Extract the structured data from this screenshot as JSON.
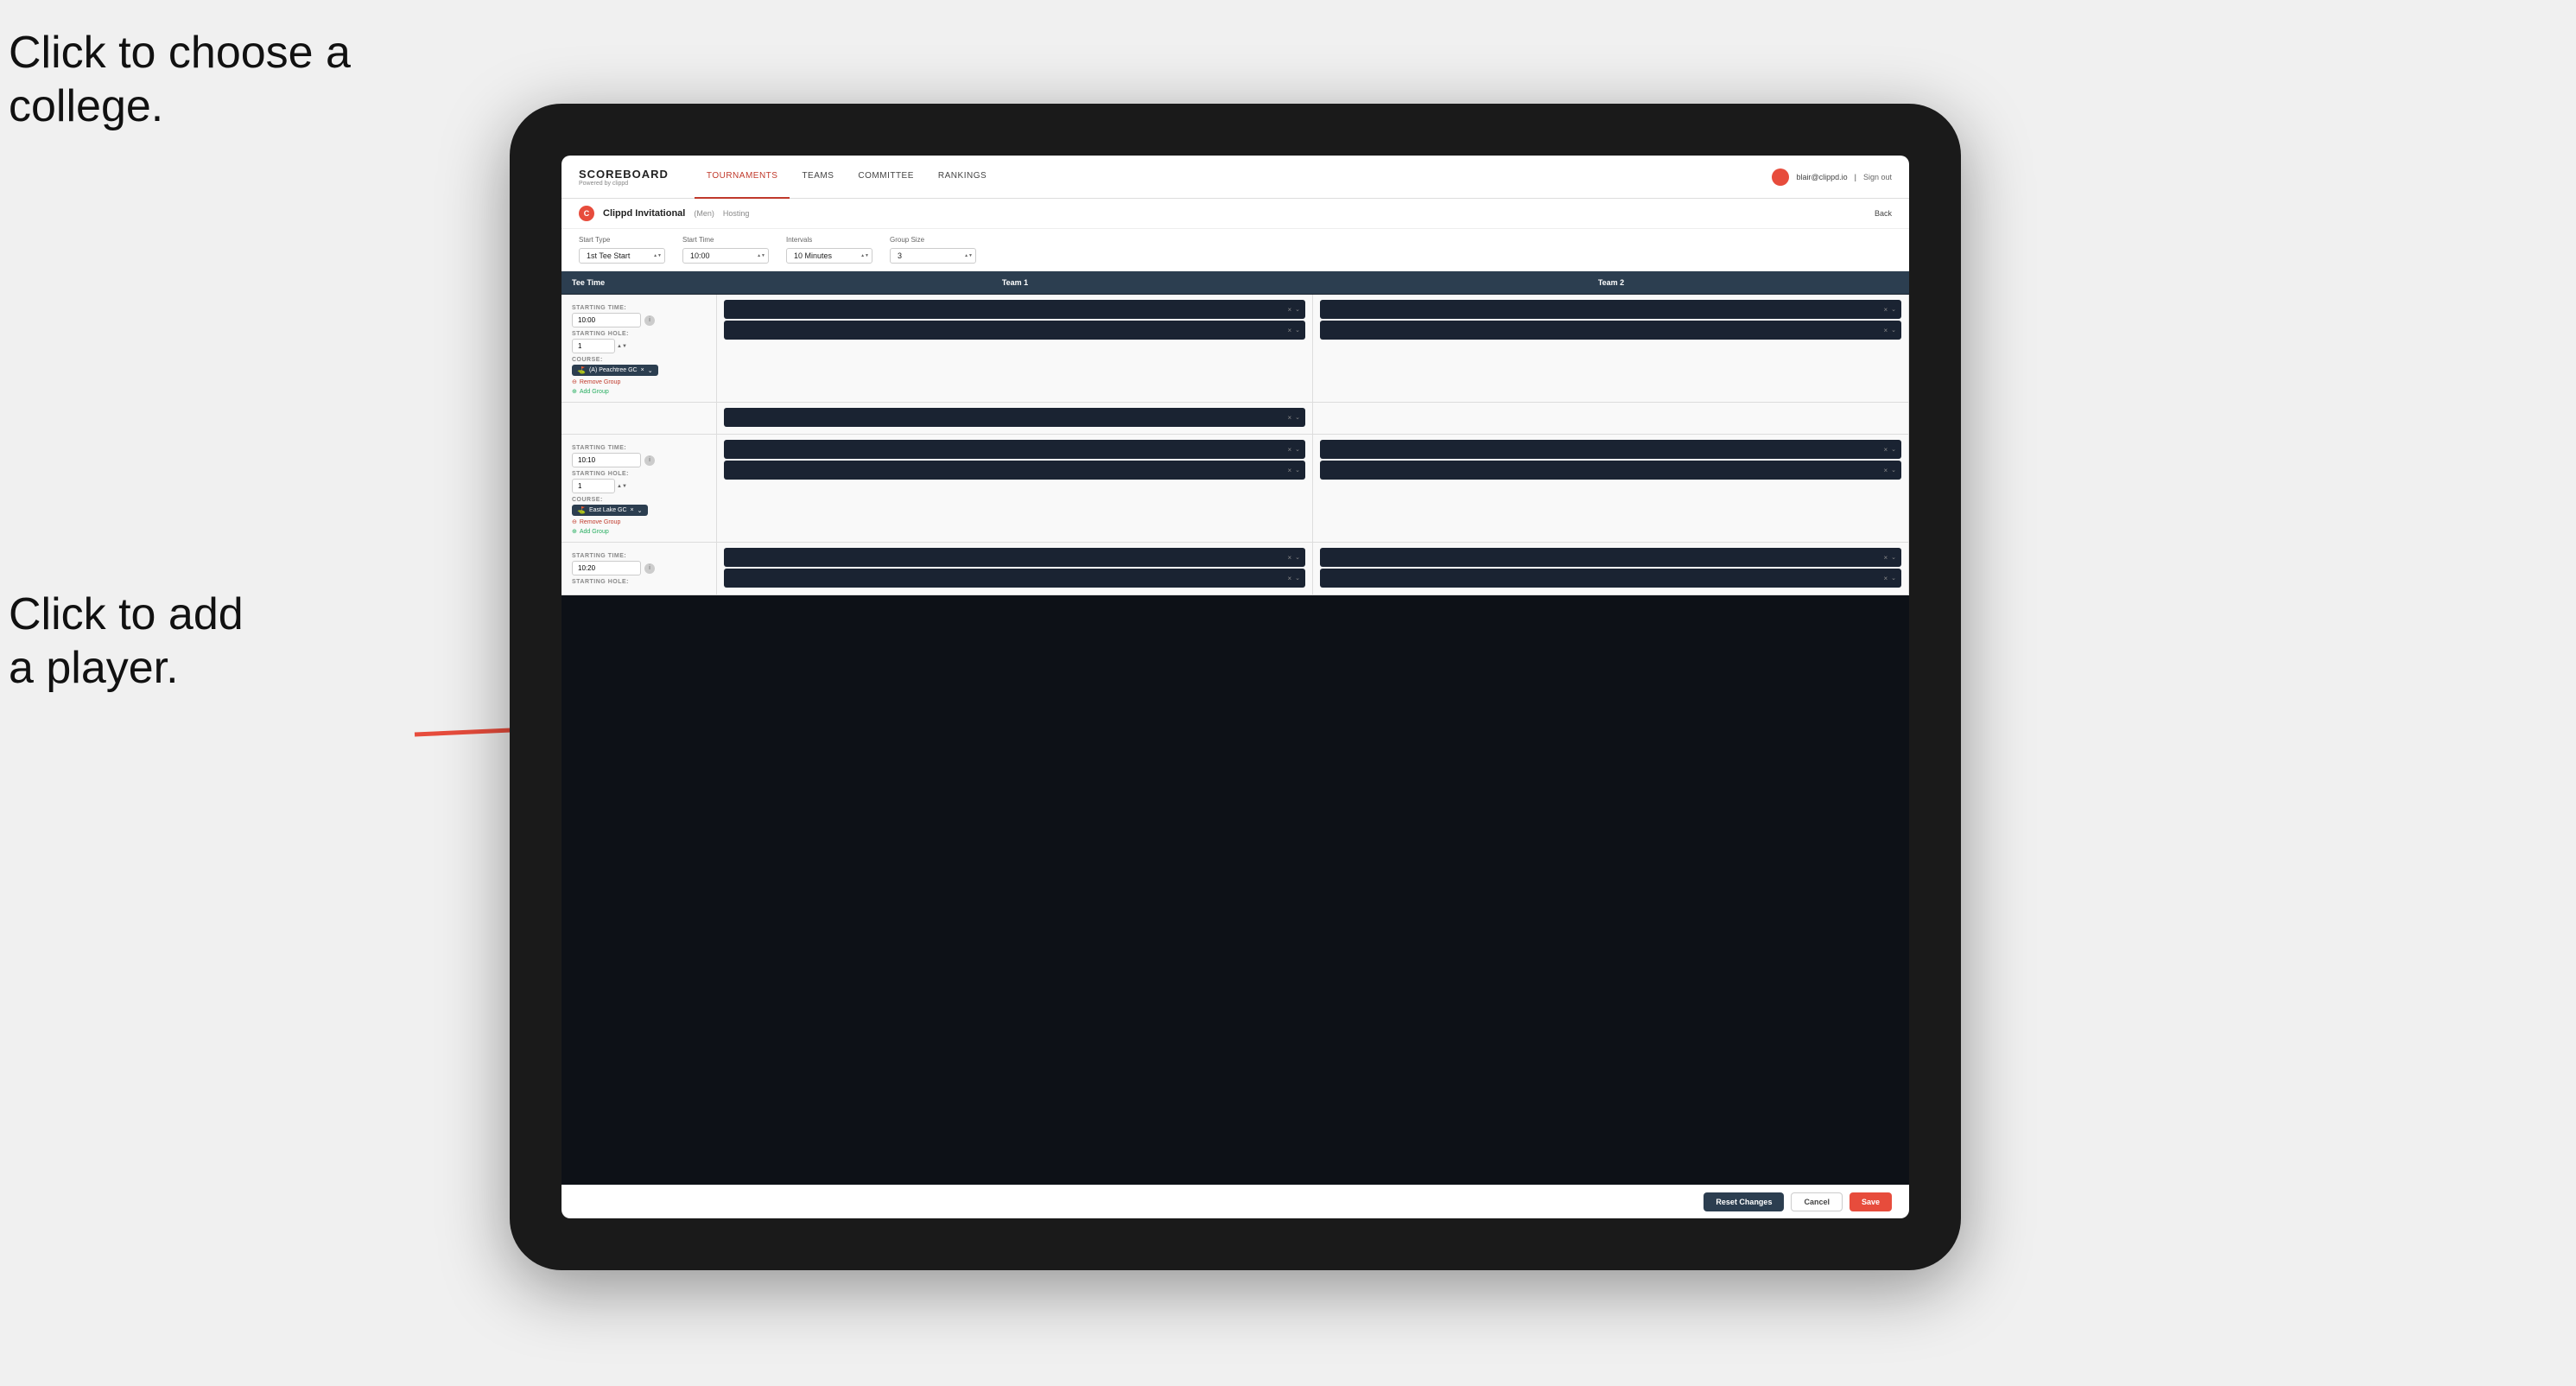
{
  "annotations": {
    "text1_line1": "Click to choose a",
    "text1_line2": "college.",
    "text2_line1": "Click to add",
    "text2_line2": "a player."
  },
  "nav": {
    "logo": "SCOREBOARD",
    "logo_sub": "Powered by clippd",
    "links": [
      "TOURNAMENTS",
      "TEAMS",
      "COMMITTEE",
      "RANKINGS"
    ],
    "active_link": "TOURNAMENTS",
    "user_email": "blair@clippd.io",
    "sign_out": "Sign out"
  },
  "sub_header": {
    "logo_letter": "C",
    "tournament": "Clippd Invitational",
    "gender": "(Men)",
    "hosting": "Hosting",
    "back": "Back"
  },
  "controls": {
    "start_type_label": "Start Type",
    "start_type_value": "1st Tee Start",
    "start_time_label": "Start Time",
    "start_time_value": "10:00",
    "intervals_label": "Intervals",
    "intervals_value": "10 Minutes",
    "group_size_label": "Group Size",
    "group_size_value": "3"
  },
  "table": {
    "col1": "Tee Time",
    "col2": "Team 1",
    "col3": "Team 2"
  },
  "groups": [
    {
      "starting_time": "10:00",
      "starting_hole": "1",
      "course": "(A) Peachtree GC",
      "team1_players": 2,
      "team2_players": 2
    },
    {
      "starting_time": "10:10",
      "starting_hole": "1",
      "course": "East Lake GC",
      "team1_players": 2,
      "team2_players": 2
    },
    {
      "starting_time": "10:20",
      "starting_hole": "",
      "course": "",
      "team1_players": 2,
      "team2_players": 2
    }
  ],
  "buttons": {
    "reset": "Reset Changes",
    "cancel": "Cancel",
    "save": "Save"
  }
}
